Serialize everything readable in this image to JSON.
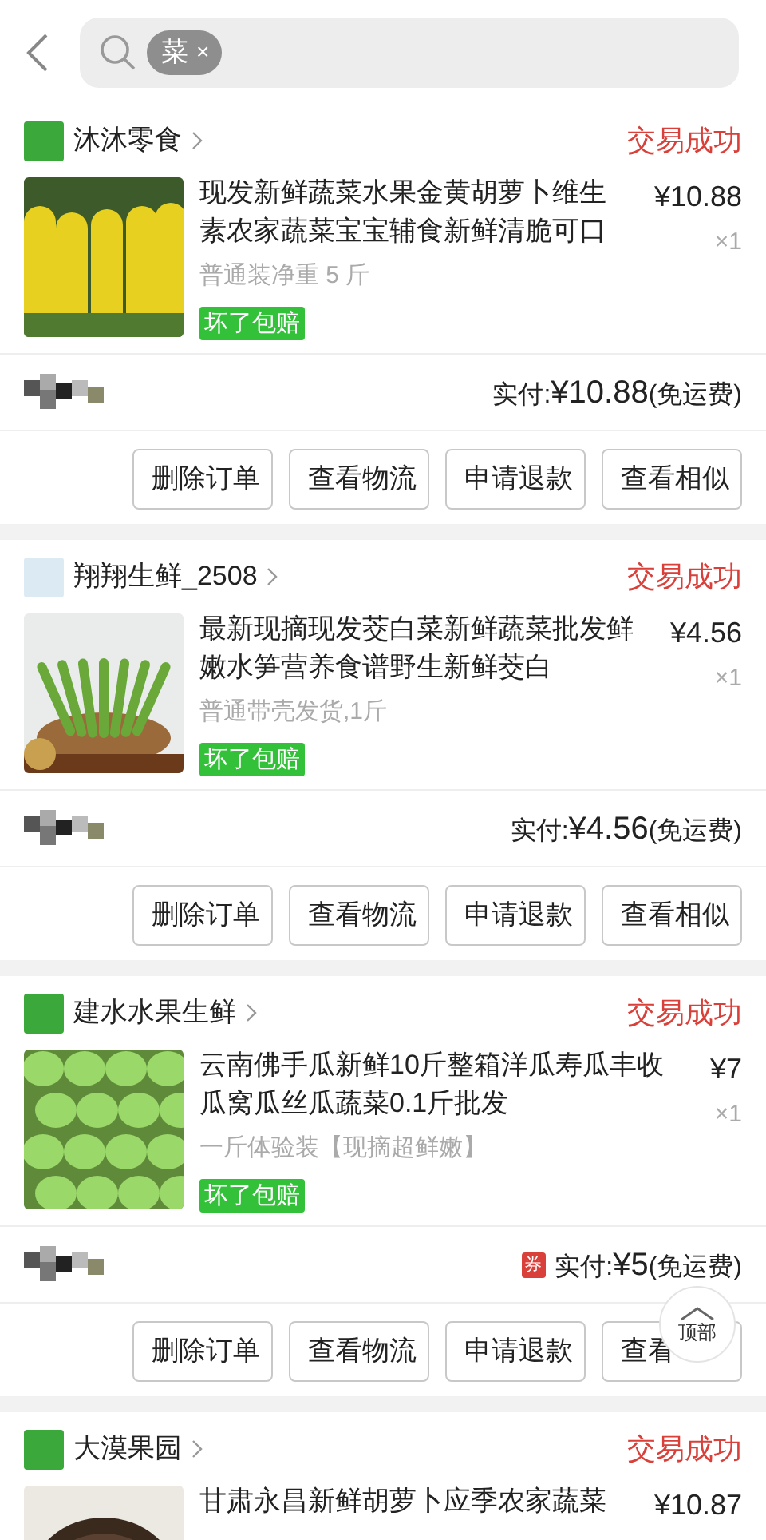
{
  "search": {
    "tag": "菜",
    "tag_close": "×"
  },
  "orders": [
    {
      "shop": "沐沐零食",
      "status": "交易成功",
      "title": "现发新鲜蔬菜水果金黄胡萝卜维生素农家蔬菜宝宝辅食新鲜清脆可口",
      "spec": "普通装净重 5 斤",
      "badge": "坏了包赔",
      "price": "¥10.88",
      "qty": "×1",
      "paid_label": "实付:",
      "paid": "¥10.88",
      "shipping": "(免运费)",
      "buttons": [
        "删除订单",
        "查看物流",
        "申请退款",
        "查看相似"
      ]
    },
    {
      "shop": "翔翔生鲜_2508",
      "status": "交易成功",
      "title": "最新现摘现发茭白菜新鲜蔬菜批发鲜嫩水笋营养食谱野生新鲜茭白",
      "spec": "普通带壳发货,1斤",
      "badge": "坏了包赔",
      "price": "¥4.56",
      "qty": "×1",
      "paid_label": "实付:",
      "paid": "¥4.56",
      "shipping": "(免运费)",
      "buttons": [
        "删除订单",
        "查看物流",
        "申请退款",
        "查看相似"
      ]
    },
    {
      "shop": "建水水果生鲜",
      "status": "交易成功",
      "title": "云南佛手瓜新鲜10斤整箱洋瓜寿瓜丰收瓜窝瓜丝瓜蔬菜0.1斤批发",
      "spec": "一斤体验装【现摘超鲜嫩】",
      "badge": "坏了包赔",
      "price": "¥7",
      "qty": "×1",
      "coupon": "券",
      "paid_label": "实付:",
      "paid": "¥5",
      "shipping": "(免运费)",
      "buttons": [
        "删除订单",
        "查看物流",
        "申请退款",
        "查看"
      ]
    },
    {
      "shop": "大漠果园",
      "status": "交易成功",
      "title": "甘肃永昌新鲜胡萝卜应季农家蔬菜",
      "price": "¥10.87"
    }
  ],
  "back_to_top": "顶部"
}
